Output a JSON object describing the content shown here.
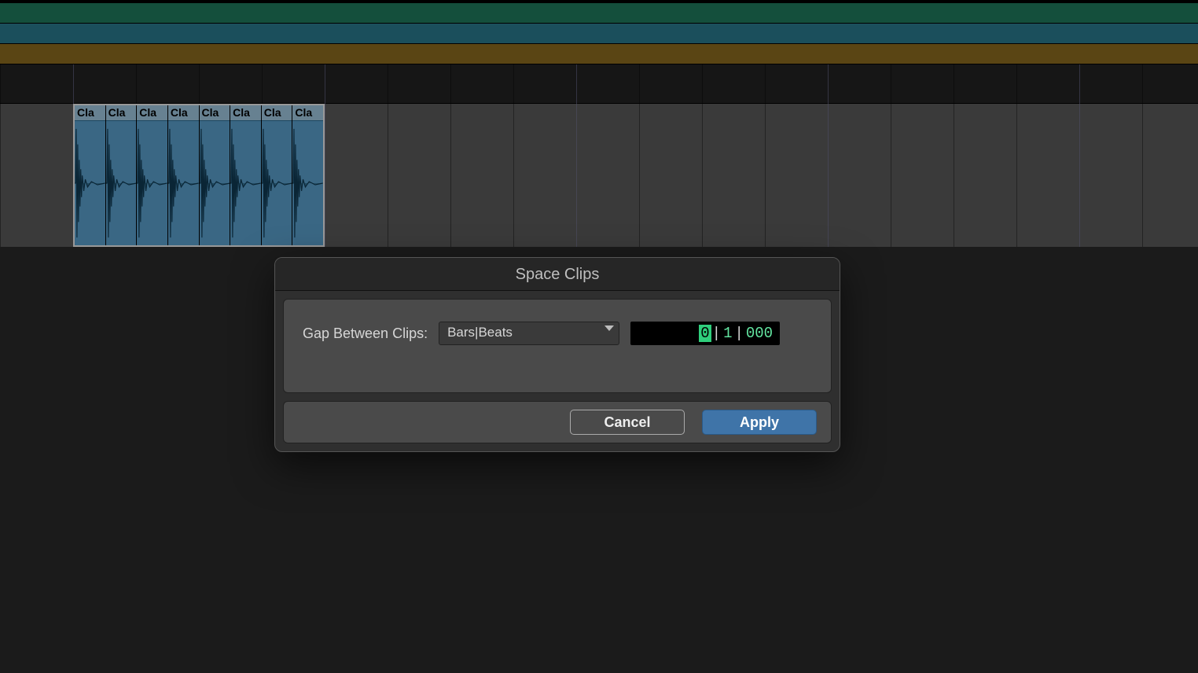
{
  "tracks": {
    "clip_label": "Cla",
    "clip_count": 8
  },
  "dialog": {
    "title": "Space Clips",
    "field_label": "Gap Between Clips:",
    "unit_selected": "Bars|Beats",
    "time_value": {
      "bars": "0",
      "beats": "1",
      "ticks": "000",
      "selected_segment": "bars"
    },
    "buttons": {
      "cancel": "Cancel",
      "apply": "Apply"
    }
  },
  "colors": {
    "strip_green": "#1f7a5c",
    "strip_teal": "#2a7a8e",
    "strip_brown": "#8a6a20",
    "clip_fill": "#5a9fcb",
    "accent_green": "#63e6a1",
    "apply_blue": "#3f74a8"
  }
}
